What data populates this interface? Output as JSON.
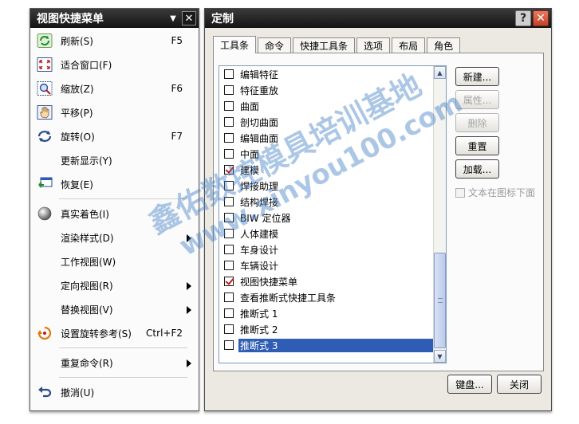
{
  "quick_menu": {
    "title": "视图快捷菜单",
    "items": [
      {
        "label": "刷新(S)",
        "shortcut": "F5",
        "icon": "refresh-icon"
      },
      {
        "label": "适合窗口(F)",
        "shortcut": "",
        "icon": "fit-window-icon"
      },
      {
        "label": "缩放(Z)",
        "shortcut": "F6",
        "icon": "zoom-icon"
      },
      {
        "label": "平移(P)",
        "shortcut": "",
        "icon": "pan-icon"
      },
      {
        "label": "旋转(O)",
        "shortcut": "F7",
        "icon": "rotate-icon"
      },
      {
        "label": "更新显示(Y)",
        "shortcut": "",
        "icon": ""
      },
      {
        "label": "恢复(E)",
        "shortcut": "",
        "icon": "restore-icon"
      },
      {
        "label": "真实着色(I)",
        "shortcut": "",
        "icon": "true-shading-icon"
      },
      {
        "label": "渲染样式(D)",
        "shortcut": "",
        "icon": ""
      },
      {
        "label": "工作视图(W)",
        "shortcut": "",
        "icon": ""
      },
      {
        "label": "定向视图(R)",
        "shortcut": "",
        "icon": ""
      },
      {
        "label": "替换视图(V)",
        "shortcut": "",
        "icon": ""
      },
      {
        "label": "设置旋转参考(S)",
        "shortcut": "Ctrl+F2",
        "icon": "rotation-reference-icon"
      },
      {
        "label": "重复命令(R)",
        "shortcut": "",
        "icon": ""
      },
      {
        "label": "撤消(U)",
        "shortcut": "",
        "icon": "undo-icon"
      }
    ]
  },
  "dialog": {
    "title": "定制",
    "help": "?",
    "tabs": [
      "工具条",
      "命令",
      "快捷工具条",
      "选项",
      "布局",
      "角色"
    ],
    "list": [
      {
        "label": "编辑特征",
        "checked": false
      },
      {
        "label": "特征重放",
        "checked": false
      },
      {
        "label": "曲面",
        "checked": false
      },
      {
        "label": "剖切曲面",
        "checked": false
      },
      {
        "label": "编辑曲面",
        "checked": false
      },
      {
        "label": "中面",
        "checked": false
      },
      {
        "label": "建模",
        "checked": true
      },
      {
        "label": "焊接助理",
        "checked": false
      },
      {
        "label": "结构焊接",
        "checked": false
      },
      {
        "label": "BIW 定位器",
        "checked": false
      },
      {
        "label": "人体建模",
        "checked": false
      },
      {
        "label": "车身设计",
        "checked": false
      },
      {
        "label": "车辆设计",
        "checked": false
      },
      {
        "label": "视图快捷菜单",
        "checked": true
      },
      {
        "label": "查看推断式快捷工具条",
        "checked": false
      },
      {
        "label": "推断式 1",
        "checked": false
      },
      {
        "label": "推断式 2",
        "checked": false
      },
      {
        "label": "推断式 3",
        "checked": false
      }
    ],
    "selected_index": 17,
    "buttons": {
      "new": "新建...",
      "properties": "属性...",
      "delete": "删除",
      "reset": "重置",
      "load": "加载..."
    },
    "show_text_label": "文本在图标下面",
    "footer": {
      "keyboard": "键盘...",
      "close": "关闭"
    }
  },
  "watermark": {
    "line1": "鑫佑数控模具培训基地",
    "line2": "www.xinyou100.com"
  }
}
